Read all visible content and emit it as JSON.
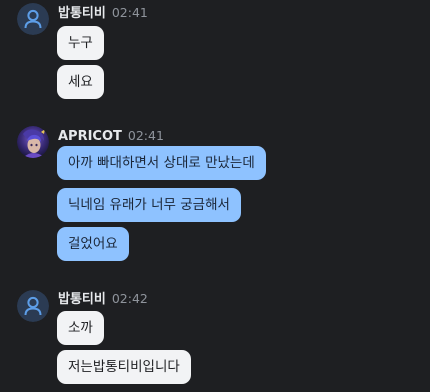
{
  "groups": [
    {
      "username": "밥통티비",
      "time": "02:41",
      "avatar": "default-user-icon",
      "messages": [
        "누구",
        "세요"
      ]
    },
    {
      "username": "APRICOT",
      "time": "02:41",
      "avatar": "profile-photo",
      "messages": [
        "아까 빠대하면서 상대로 만났는데",
        "닉네임 유래가 너무 궁금해서",
        "걸었어요"
      ]
    },
    {
      "username": "밥통티비",
      "time": "02:42",
      "avatar": "default-user-icon",
      "messages": [
        "소까",
        "저는밥통티비입니다"
      ]
    }
  ],
  "colors": {
    "background": "#1e1f22",
    "bubble_other": "#f2f3f5",
    "bubble_me": "#8ec2ff",
    "username": "#e7e9ec",
    "timestamp": "#8f949c",
    "default_avatar_bg": "#2b3b53",
    "default_avatar_fg": "#5d9ee8"
  }
}
